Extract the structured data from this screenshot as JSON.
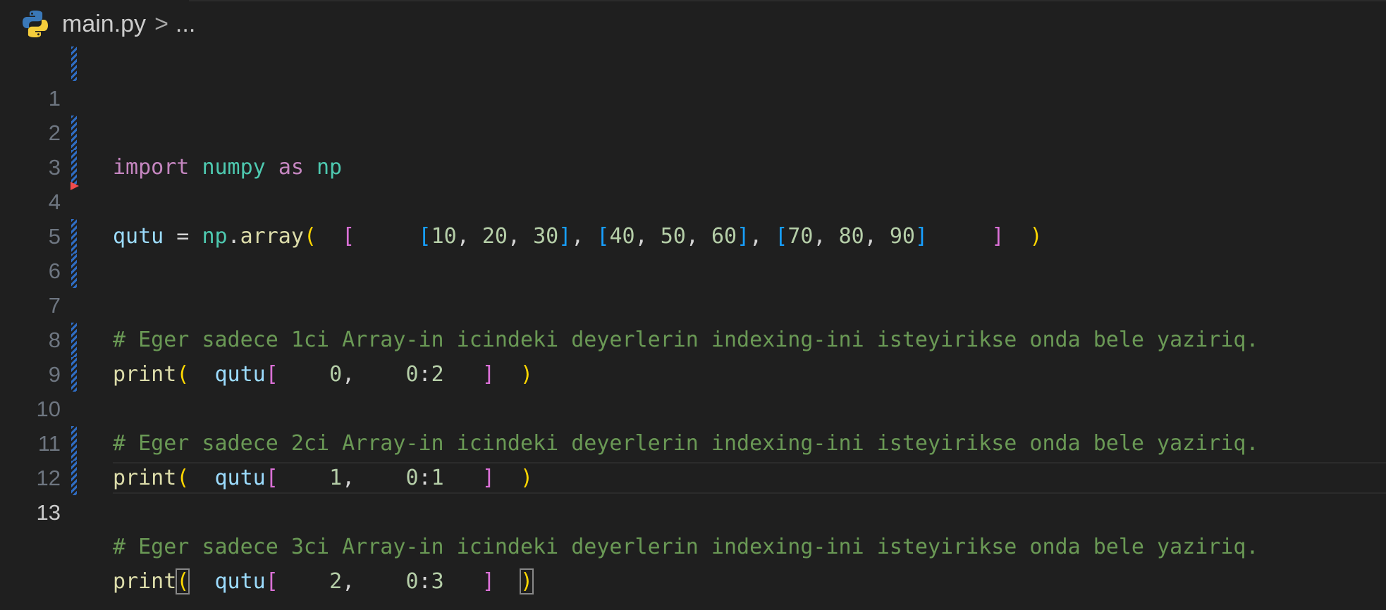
{
  "breadcrumb": {
    "file": "main.py",
    "separator": ">",
    "ellipsis": "..."
  },
  "colors": {
    "background": "#1f1f1f",
    "keyword": "#c586c0",
    "module": "#4ec9b0",
    "variable": "#9cdcfe",
    "function": "#dcdcaa",
    "number": "#b5cea8",
    "comment": "#6a9955",
    "bracket_level1": "#ffd700",
    "bracket_level2": "#da70d6",
    "bracket_level3": "#179fff",
    "git_modified": "#2f6dc4",
    "git_deleted": "#f14c4c"
  },
  "icons": {
    "file_type": "python-icon",
    "breadcrumb_separator": "chevron-right-icon"
  },
  "editor": {
    "current_line": 13,
    "lines": [
      {
        "n": "1",
        "import_kw": "import",
        "module": "numpy",
        "as_kw": "as",
        "alias": "np"
      },
      {
        "n": "2"
      },
      {
        "n": "3",
        "var": "qutu",
        "assign": " = ",
        "np": "np",
        "dot": ".",
        "fn": "array",
        "open_paren": "(",
        "sp1": "  ",
        "open_outer": "[",
        "sp2": "     ",
        "r1_open": "[",
        "r1_a": "10",
        "r1_c1": ", ",
        "r1_b": "20",
        "r1_c2": ", ",
        "r1_c": "30",
        "r1_close": "]",
        "sep1": ", ",
        "r2_open": "[",
        "r2_a": "40",
        "r2_c1": ", ",
        "r2_b": "50",
        "r2_c2": ", ",
        "r2_c": "60",
        "r2_close": "]",
        "sep2": ", ",
        "r3_open": "[",
        "r3_a": "70",
        "r3_c1": ", ",
        "r3_b": "80",
        "r3_c2": ", ",
        "r3_c": "90",
        "r3_close": "]",
        "sp3": "     ",
        "close_outer": "]",
        "sp4": "  ",
        "close_paren": ")"
      },
      {
        "n": "4"
      },
      {
        "n": "5"
      },
      {
        "n": "6",
        "comment": "# Eger sadece 1ci Array-in icindeki deyerlerin indexing-ini isteyirikse onda bele yaziriq."
      },
      {
        "n": "7",
        "fn": "print",
        "open_paren": "(",
        "sp1": "  ",
        "var": "qutu",
        "open_br": "[",
        "sp2": "    ",
        "idx": "0",
        "comma": ",",
        "sp3": "    ",
        "s1": "0",
        "colon": ":",
        "s2": "2",
        "sp4": "   ",
        "close_br": "]",
        "sp5": "  ",
        "close_paren": ")"
      },
      {
        "n": "8"
      },
      {
        "n": "9",
        "comment": "# Eger sadece 2ci Array-in icindeki deyerlerin indexing-ini isteyirikse onda bele yaziriq."
      },
      {
        "n": "10",
        "fn": "print",
        "open_paren": "(",
        "sp1": "  ",
        "var": "qutu",
        "open_br": "[",
        "sp2": "    ",
        "idx": "1",
        "comma": ",",
        "sp3": "    ",
        "s1": "0",
        "colon": ":",
        "s2": "1",
        "sp4": "   ",
        "close_br": "]",
        "sp5": "  ",
        "close_paren": ")"
      },
      {
        "n": "11"
      },
      {
        "n": "12",
        "comment": "# Eger sadece 3ci Array-in icindeki deyerlerin indexing-ini isteyirikse onda bele yaziriq."
      },
      {
        "n": "13",
        "fn": "print",
        "open_paren": "(",
        "sp1": "  ",
        "var": "qutu",
        "open_br": "[",
        "sp2": "    ",
        "idx": "2",
        "comma": ",",
        "sp3": "    ",
        "s1": "0",
        "colon": ":",
        "s2": "3",
        "sp4": "   ",
        "close_br": "]",
        "sp5": "  ",
        "close_paren": ")"
      }
    ]
  }
}
